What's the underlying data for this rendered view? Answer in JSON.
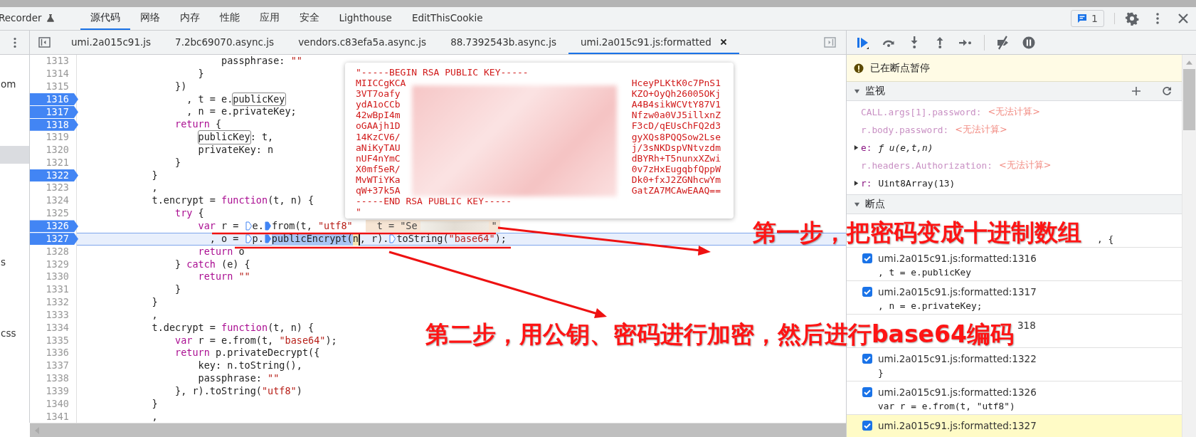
{
  "top_tabs": [
    {
      "label": "Recorder",
      "kind": "experiment",
      "selected": false
    },
    {
      "label": "源代码",
      "kind": "panel",
      "selected": true
    },
    {
      "label": "网络",
      "kind": "panel",
      "selected": false
    },
    {
      "label": "内存",
      "kind": "panel",
      "selected": false
    },
    {
      "label": "性能",
      "kind": "panel",
      "selected": false
    },
    {
      "label": "应用",
      "kind": "panel",
      "selected": false
    },
    {
      "label": "安全",
      "kind": "panel",
      "selected": false
    },
    {
      "label": "Lighthouse",
      "kind": "panel",
      "selected": false
    },
    {
      "label": "EditThisCookie",
      "kind": "panel",
      "selected": false
    }
  ],
  "issues": {
    "count": "1"
  },
  "file_tabs": [
    {
      "label": "umi.2a015c91.js",
      "selected": false,
      "closable": false
    },
    {
      "label": "7.2bc69070.async.js",
      "selected": false,
      "closable": false
    },
    {
      "label": "vendors.c83efa5a.async.js",
      "selected": false,
      "closable": false
    },
    {
      "label": "88.7392543b.async.js",
      "selected": false,
      "closable": false
    },
    {
      "label": "umi.2a015c91.js:formatted",
      "selected": true,
      "closable": true
    }
  ],
  "navigator": [
    {
      "selected": false
    },
    {
      "label": "om",
      "selected": false
    },
    {
      "selected": false
    },
    {
      "selected": false
    },
    {
      "selected": false
    },
    {
      "selected": true
    },
    {
      "selected": false
    },
    {
      "selected": false
    },
    {
      "selected": false
    },
    {
      "selected": false
    },
    {
      "selected": false
    },
    {
      "label": "s",
      "selected": false
    },
    {
      "selected": false
    },
    {
      "selected": false
    },
    {
      "selected": false
    },
    {
      "label": "css",
      "selected": false
    }
  ],
  "code": {
    "lines": [
      {
        "number": "1313",
        "breakpoint": false,
        "current": false,
        "tokens": [
          {
            "kind": "plain",
            "t": "                        passphrase: "
          },
          {
            "kind": "str",
            "t": "\"\""
          }
        ]
      },
      {
        "number": "1314",
        "breakpoint": false,
        "current": false,
        "tokens": [
          {
            "kind": "plain",
            "t": "                    }"
          }
        ]
      },
      {
        "number": "1315",
        "breakpoint": false,
        "current": false,
        "tokens": [
          {
            "kind": "plain",
            "t": "                })"
          }
        ]
      },
      {
        "number": "1316",
        "breakpoint": true,
        "current": false,
        "tokens": [
          {
            "kind": "plain",
            "t": "                  , t = e."
          },
          {
            "kind": "match",
            "t": "publicKey"
          }
        ]
      },
      {
        "number": "1317",
        "breakpoint": true,
        "current": false,
        "tokens": [
          {
            "kind": "plain",
            "t": "                  , n = e.privateKey;"
          }
        ]
      },
      {
        "number": "1318",
        "breakpoint": true,
        "current": false,
        "tokens": [
          {
            "kind": "kw",
            "t": "                return"
          },
          {
            "kind": "plain",
            "t": " {"
          }
        ]
      },
      {
        "number": "1319",
        "breakpoint": false,
        "current": false,
        "tokens": [
          {
            "kind": "match",
            "t": "                    publicKey"
          },
          {
            "kind": "plain",
            "t": ": t,"
          }
        ]
      },
      {
        "number": "1320",
        "breakpoint": false,
        "current": false,
        "tokens": [
          {
            "kind": "plain",
            "t": "                    privateKey: n"
          }
        ]
      },
      {
        "number": "1321",
        "breakpoint": false,
        "current": false,
        "tokens": [
          {
            "kind": "plain",
            "t": "                }"
          }
        ]
      },
      {
        "number": "1322",
        "breakpoint": true,
        "current": false,
        "tokens": [
          {
            "kind": "plain",
            "t": "            }"
          }
        ]
      },
      {
        "number": "1323",
        "breakpoint": false,
        "current": false,
        "tokens": [
          {
            "kind": "plain",
            "t": "            ,"
          }
        ]
      },
      {
        "number": "1324",
        "breakpoint": false,
        "current": false,
        "tokens": [
          {
            "kind": "plain",
            "t": "            t.encrypt = "
          },
          {
            "kind": "kw",
            "t": "function"
          },
          {
            "kind": "plain",
            "t": "(t, n) {"
          }
        ]
      },
      {
        "number": "1325",
        "breakpoint": false,
        "current": false,
        "tokens": [
          {
            "kind": "kw",
            "t": "                try"
          },
          {
            "kind": "plain",
            "t": " {"
          }
        ]
      },
      {
        "number": "1326",
        "breakpoint": true,
        "current": false,
        "tokens": [
          {
            "kind": "kw",
            "t": "                    var"
          },
          {
            "kind": "plain",
            "t": " r = "
          },
          {
            "kind": "marker",
            "filled": false
          },
          {
            "kind": "plain",
            "t": "e."
          },
          {
            "kind": "marker",
            "filled": true
          },
          {
            "kind": "plain",
            "t": "from(t, "
          },
          {
            "kind": "str",
            "t": "\"utf8\""
          },
          {
            "kind": "value",
            "t": "t = \"Se",
            "after": "\""
          }
        ]
      },
      {
        "number": "1327",
        "breakpoint": true,
        "current": true,
        "tokens": [
          {
            "kind": "plain",
            "t": "                      , o = "
          },
          {
            "kind": "marker",
            "filled": false
          },
          {
            "kind": "plain",
            "t": "p."
          },
          {
            "kind": "marker",
            "filled": true
          },
          {
            "kind": "sel",
            "t": "publicEncrypt("
          },
          {
            "kind": "hit",
            "t": "n"
          },
          {
            "kind": "plain",
            "t": ", r)."
          },
          {
            "kind": "marker",
            "filled": false
          },
          {
            "kind": "plain",
            "t": "toString("
          },
          {
            "kind": "str",
            "t": "\"base64\""
          },
          {
            "kind": "plain",
            "t": ");"
          }
        ]
      },
      {
        "number": "1328",
        "breakpoint": false,
        "current": false,
        "tokens": [
          {
            "kind": "kw",
            "t": "                    return"
          },
          {
            "kind": "plain",
            "t": " o"
          }
        ]
      },
      {
        "number": "1329",
        "breakpoint": false,
        "current": false,
        "tokens": [
          {
            "kind": "plain",
            "t": "                } "
          },
          {
            "kind": "kw",
            "t": "catch"
          },
          {
            "kind": "plain",
            "t": " (e) {"
          }
        ]
      },
      {
        "number": "1330",
        "breakpoint": false,
        "current": false,
        "tokens": [
          {
            "kind": "kw",
            "t": "                    return"
          },
          {
            "kind": "str",
            "t": " \"\""
          }
        ]
      },
      {
        "number": "1331",
        "breakpoint": false,
        "current": false,
        "tokens": [
          {
            "kind": "plain",
            "t": "                }"
          }
        ]
      },
      {
        "number": "1332",
        "breakpoint": false,
        "current": false,
        "tokens": [
          {
            "kind": "plain",
            "t": "            }"
          }
        ]
      },
      {
        "number": "1333",
        "breakpoint": false,
        "current": false,
        "tokens": [
          {
            "kind": "plain",
            "t": "            ,"
          }
        ]
      },
      {
        "number": "1334",
        "breakpoint": false,
        "current": false,
        "tokens": [
          {
            "kind": "plain",
            "t": "            t.decrypt = "
          },
          {
            "kind": "kw",
            "t": "function"
          },
          {
            "kind": "plain",
            "t": "(t, n) {"
          }
        ]
      },
      {
        "number": "1335",
        "breakpoint": false,
        "current": false,
        "tokens": [
          {
            "kind": "kw",
            "t": "                var"
          },
          {
            "kind": "plain",
            "t": " r = e.from(t, "
          },
          {
            "kind": "str",
            "t": "\"base64\""
          },
          {
            "kind": "plain",
            "t": ");"
          }
        ]
      },
      {
        "number": "1336",
        "breakpoint": false,
        "current": false,
        "tokens": [
          {
            "kind": "kw",
            "t": "                return"
          },
          {
            "kind": "plain",
            "t": " p.privateDecrypt({"
          }
        ]
      },
      {
        "number": "1337",
        "breakpoint": false,
        "current": false,
        "tokens": [
          {
            "kind": "plain",
            "t": "                    key: n.toString(),"
          }
        ]
      },
      {
        "number": "1338",
        "breakpoint": false,
        "current": false,
        "tokens": [
          {
            "kind": "plain",
            "t": "                    passphrase: "
          },
          {
            "kind": "str",
            "t": "\"\""
          }
        ]
      },
      {
        "number": "1339",
        "breakpoint": false,
        "current": false,
        "tokens": [
          {
            "kind": "plain",
            "t": "                }, r).toString("
          },
          {
            "kind": "str",
            "t": "\"utf8\""
          },
          {
            "kind": "plain",
            "t": ")"
          }
        ]
      },
      {
        "number": "1340",
        "breakpoint": false,
        "current": false,
        "tokens": [
          {
            "kind": "plain",
            "t": "            }"
          }
        ]
      },
      {
        "number": "1341",
        "breakpoint": false,
        "current": false,
        "tokens": [
          {
            "kind": "plain",
            "t": "            ,"
          }
        ]
      }
    ]
  },
  "popup": {
    "first": "\"-----BEGIN RSA PUBLIC KEY-----",
    "rows": [
      {
        "left": "MIICCgKCA",
        "right": "HceyPLKtK0c7PnS1"
      },
      {
        "left": "3VT7oafy",
        "right": "KZO+OyQh26005OKj"
      },
      {
        "left": "ydA1oCCb",
        "right": "A4B4sikWCVtY87V1"
      },
      {
        "left": "42wBpI4m",
        "right": "Nfzw0a0VJ5illxnZ"
      },
      {
        "left": "oGAAjh1D",
        "right": "F3cD/qEUsChFQ2d3"
      },
      {
        "left": "14KzCV6/",
        "right": "gyXQs8PQQSow2Lse"
      },
      {
        "left": "aNiKyTAU",
        "right": "j/3sNKDspVNtvzdm"
      },
      {
        "left": "nUF4nYmC",
        "right": "dBYRh+T5nunxXZwi"
      },
      {
        "left": "X0mf5eR/",
        "right": "0v7zHxEugqbfQppW"
      },
      {
        "left": "MvWTiYKa",
        "right": "Dk0+fxJ2ZGNhcwYm"
      },
      {
        "left": "qW+37k5A",
        "right": "GatZA7MCAwEAAQ=="
      }
    ],
    "last": "-----END RSA PUBLIC KEY-----",
    "close": "\""
  },
  "paused_banner": "已在断点暂停",
  "watch": {
    "title": "监视",
    "expanded": true,
    "items": [
      {
        "kind": "error",
        "name": "CALL.args[1].password:",
        "value": "<无法计算>"
      },
      {
        "kind": "error",
        "name": "r.body.password:",
        "value": "<无法计算>"
      },
      {
        "kind": "function",
        "name": "e:",
        "value": "ƒ u(e,t,n)",
        "expanded": false
      },
      {
        "kind": "error",
        "name": "r.headers.Authorization:",
        "value": "<无法计算>"
      },
      {
        "kind": "object",
        "name": "r:",
        "value": "Uint8Array(13)",
        "expanded": false
      }
    ]
  },
  "breakpoints": {
    "title": "断点",
    "expanded": true,
    "items": [
      {
        "code_tail": ", {",
        "current": false
      },
      {
        "location": "umi.2a015c91.js:formatted:1316",
        "code": ", t = e.publicKey",
        "checked": true,
        "current": false
      },
      {
        "location": "umi.2a015c91.js:formatted:1317",
        "code": ", n = e.privateKey;",
        "checked": true,
        "current": false
      },
      {
        "location_tail": "318",
        "current": false
      },
      {
        "location": "umi.2a015c91.js:formatted:1322",
        "code": "}",
        "checked": true,
        "current": false
      },
      {
        "location": "umi.2a015c91.js:formatted:1326",
        "code": "var r = e.from(t, \"utf8\")",
        "checked": true,
        "current": false
      },
      {
        "location": "umi.2a015c91.js:formatted:1327",
        "checked": true,
        "current": true
      }
    ]
  },
  "annotations": [
    {
      "kind": "step1",
      "text": "第一步，把密码变成十进制数组"
    },
    {
      "kind": "step2",
      "text": "第二步，用公钥、密码进行加密，然后进行base64编码"
    }
  ]
}
